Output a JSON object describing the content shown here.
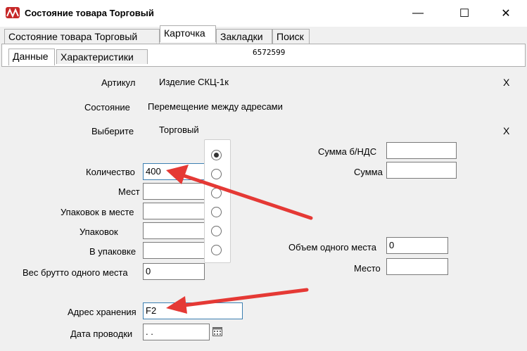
{
  "window": {
    "title": "Состояние товара Торговый",
    "icon": "app-logo-icon",
    "controls": {
      "minimize": "—",
      "maximize": "☐",
      "close": "✕"
    }
  },
  "tabs": [
    "Состояние товара Торговый",
    "Карточка",
    "Закладки",
    "Поиск"
  ],
  "active_tab": "Карточка",
  "subtabs": [
    "Данные",
    "Характеристики"
  ],
  "active_subtab": "Данные",
  "card_code": "6572599",
  "fields": {
    "article": {
      "label": "Артикул",
      "value": "Изделие СКЦ-1к",
      "clear": "X"
    },
    "state": {
      "label": "Состояние",
      "value": "Перемещение между адресами"
    },
    "choose": {
      "label": "Выберите",
      "value": "Торговый",
      "clear": "X"
    },
    "quantity": {
      "label": "Количество",
      "value": "400"
    },
    "places": {
      "label": "Мест",
      "value": ""
    },
    "packs_per_place": {
      "label": "Упаковок в месте",
      "value": ""
    },
    "packs": {
      "label": "Упаковок",
      "value": ""
    },
    "in_pack": {
      "label": "В упаковке",
      "value": ""
    },
    "gross_weight": {
      "label": "Вес брутто одного места",
      "value": "0"
    },
    "sum_no_vat": {
      "label": "Сумма  б/НДС",
      "value": ""
    },
    "sum": {
      "label": "Сумма",
      "value": ""
    },
    "place_volume": {
      "label": "Объем одного места",
      "value": "0"
    },
    "place": {
      "label": "Место",
      "value": ""
    },
    "storage_address": {
      "label": "Адрес хранения",
      "value": "F2"
    },
    "posting_date": {
      "label": "Дата проводки",
      "value": " .  ."
    }
  },
  "radio_options": {
    "selected_index": 0,
    "count": 6
  },
  "colors": {
    "arrow": "#e53935",
    "focus_border": "#3c7fb1"
  }
}
